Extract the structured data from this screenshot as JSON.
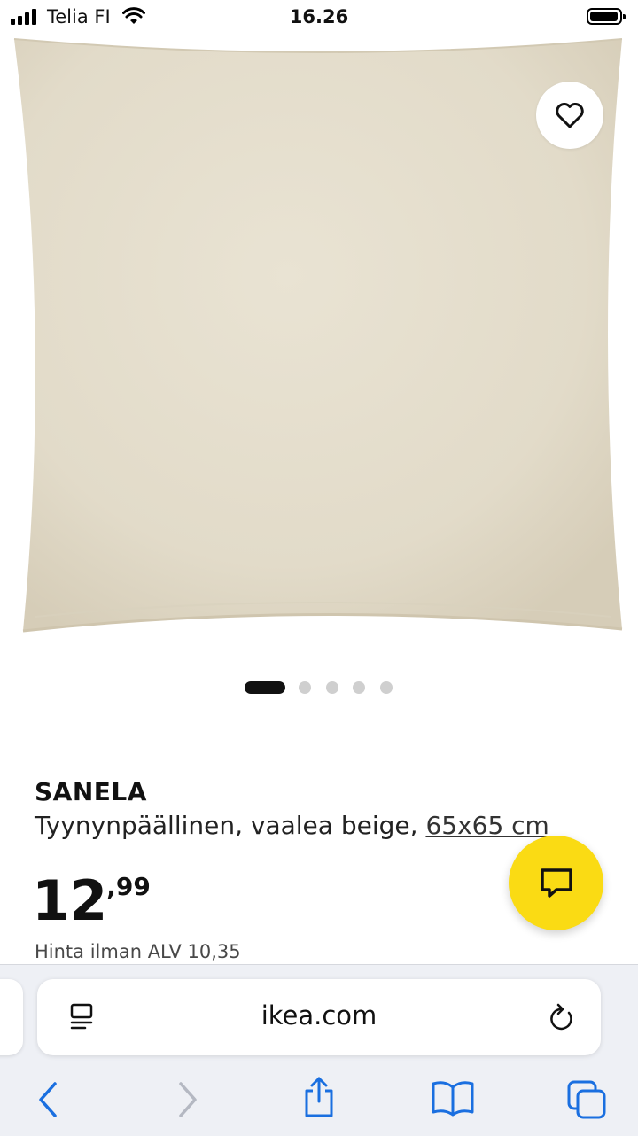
{
  "status_bar": {
    "carrier": "Telia FI",
    "time": "16.26"
  },
  "product": {
    "name": "SANELA",
    "description": "Tyynynpäällinen, vaalea beige, ",
    "size": "65x65 cm",
    "price_integer": "12",
    "price_decimal": ",99",
    "price_without_vat": "Hinta ilman ALV 10,35",
    "image_count": 5,
    "active_image_index": 0
  },
  "browser": {
    "url": "ikea.com"
  },
  "colors": {
    "chat_button": "#fadb14",
    "pillow": "#e3dccb",
    "safari_link": "#1a6fe0"
  }
}
